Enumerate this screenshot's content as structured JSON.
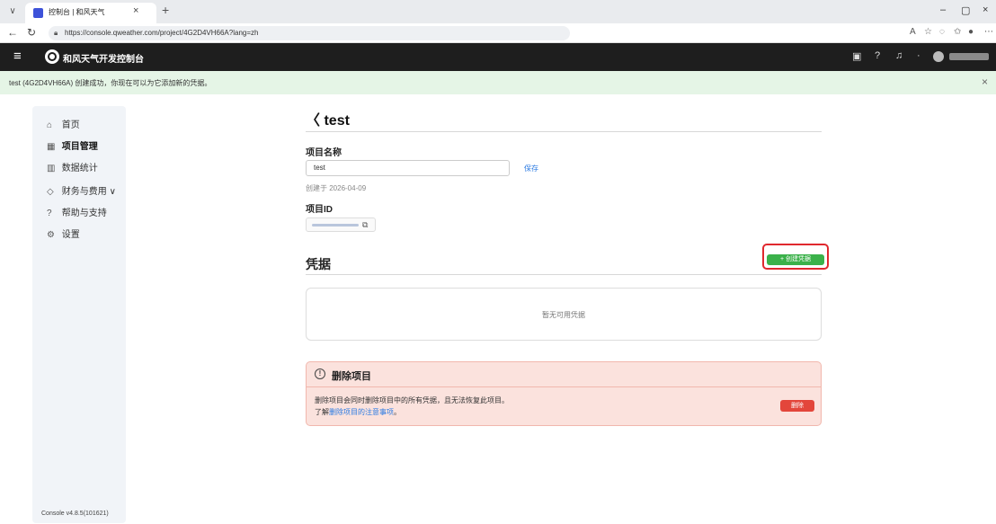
{
  "browser": {
    "tab_title": "控制台 | 和风天气",
    "tab_close": "×",
    "new_tab": "+",
    "url": "https://console.qweather.com/project/4G2D4VH66A?lang=zh",
    "window_controls": [
      "–",
      "▢",
      "×"
    ]
  },
  "app": {
    "title": "和风天气开发控制台",
    "header_icons": [
      "doc-icon",
      "help-icon",
      "bell-icon",
      "avatar-icon"
    ]
  },
  "banner": {
    "text": "test (4G2D4VH66A) 创建成功，你现在可以为它添加新的凭据。",
    "close": "×"
  },
  "sidebar": {
    "items": [
      {
        "label": "首页",
        "icon": "home-icon",
        "glyph": "⌂"
      },
      {
        "label": "项目管理",
        "icon": "grid-icon",
        "glyph": "▦"
      },
      {
        "label": "数据统计",
        "icon": "bar-chart-icon",
        "glyph": "▥"
      },
      {
        "label": "财务与费用",
        "icon": "tag-icon",
        "glyph": "◇",
        "suffix": "∨"
      },
      {
        "label": "帮助与支持",
        "icon": "help-icon",
        "glyph": "?"
      },
      {
        "label": "设置",
        "icon": "gear-icon",
        "glyph": "⚙"
      }
    ],
    "version": "Console v4.8.5(101621)"
  },
  "main": {
    "back": "〈",
    "title": "test",
    "project_name_label": "项目名称",
    "project_name_value": "test",
    "save_label": "保存",
    "created": "创建于 2026-04-09",
    "project_id_label": "项目ID",
    "credentials_title": "凭据",
    "create_button": "+ 创建凭据",
    "empty_text": "暂无可用凭据",
    "danger": {
      "title": "删除项目",
      "desc": "删除项目会同时删除项目中的所有凭据，且无法恢复此项目。",
      "more_prefix": "了解",
      "more_link": "删除项目的注意事项",
      "more_suffix": "。",
      "button": "删除"
    }
  }
}
